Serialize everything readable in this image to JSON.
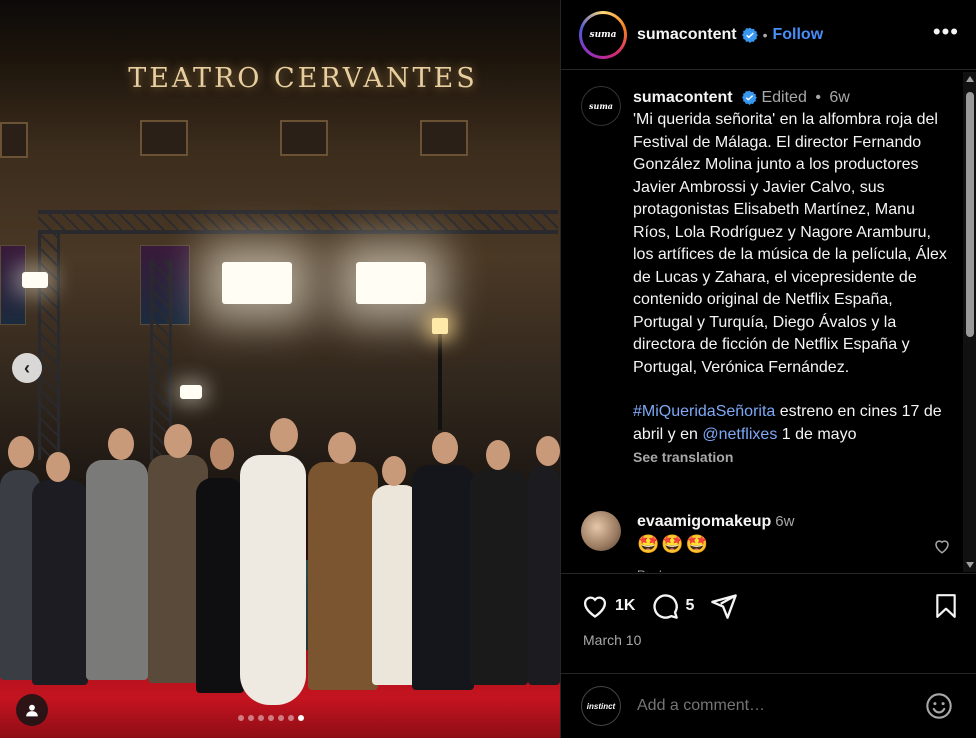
{
  "photo": {
    "sign_text": "TEATRO CERVANTES",
    "carousel_dots": 7,
    "active_dot": 6,
    "prev_icon": "chevron-left-icon",
    "tag_icon": "user-tag-icon"
  },
  "header": {
    "avatar_text": "suma",
    "username": "sumacontent",
    "separator": "•",
    "follow_label": "Follow",
    "more_icon": "•••"
  },
  "caption": {
    "avatar_text": "suma",
    "username": "sumacontent",
    "edited": "Edited",
    "separator": "•",
    "time": "6w",
    "text": "'Mi querida señorita' en la alfombra roja del Festival de Málaga. El director Fernando González Molina junto a los productores Javier Ambrossi y Javier Calvo, sus protagonistas Elisabeth Martínez, Manu Ríos, Lola Rodríguez y Nagore Aramburu, los artífices de la música de la película, Álex de Lucas y Zahara, el vicepresidente de contenido original de Netflix España, Portugal y Turquía, Diego Ávalos y la directora de ficción de Netflix España y Portugal, Verónica Fernández.",
    "hashtag": "#MiQueridaSeñorita",
    "text2": " estreno en cines 17 de abril y en ",
    "mention": "@netflixes",
    "text3": " 1 de mayo",
    "see_translation": "See translation"
  },
  "comment": {
    "username": "evaamigomakeup",
    "time": "6w",
    "text": "🤩🤩🤩",
    "reply": "Reply"
  },
  "actions": {
    "likes": "1K",
    "comments": "5",
    "date": "March 10"
  },
  "comment_bar": {
    "avatar_text": "instinct",
    "placeholder": "Add a comment…"
  },
  "colors": {
    "follow": "#4a8df8",
    "link": "#7ea8f5",
    "verified": "#3897f0",
    "muted": "#a8a8a8"
  }
}
